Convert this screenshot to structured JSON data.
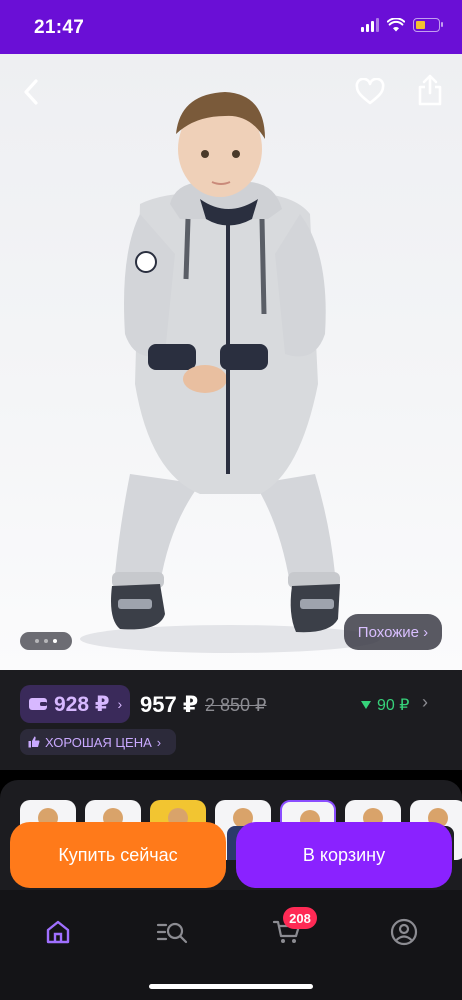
{
  "status_bar": {
    "time": "21:47",
    "icons": [
      "signal-icon",
      "wifi-icon",
      "battery-icon"
    ],
    "battery_level": 0.25,
    "colors": {
      "background": "#6a0fd6",
      "battery": "#f3c230"
    }
  },
  "photo": {
    "icons": [
      "back-icon",
      "heart-icon",
      "share-icon"
    ],
    "gallery_dots": 3,
    "active_dot": 2,
    "similar_label": "Похожие ›"
  },
  "price": {
    "wallet_price": "928 ₽",
    "wallet_chevron": "›",
    "current_price": "957 ₽",
    "old_price": "2 850 ₽",
    "bonus": "90 ₽",
    "bonus_chevron": "›",
    "good_price_badge": "ХОРОШАЯ ЦЕНА",
    "good_price_chevron": "›",
    "colors": {
      "accent": "#8a22ff",
      "bonus": "#36d27a"
    }
  },
  "variants": {
    "count": 7,
    "selected_index": 4,
    "colors": [
      "#f2c531",
      "#2f8d3a",
      "#c8243a",
      "#2b3a6b",
      "#3b4a7a",
      "#e6462d",
      "#1e1e24"
    ]
  },
  "actions": {
    "buy_now": "Купить сейчас",
    "add_to_cart": "В корзину",
    "colors": {
      "buy_now": "#ff7a1a",
      "add_to_cart": "#8a22ff"
    }
  },
  "tab_bar": {
    "items": [
      {
        "name": "home",
        "icon": "home-icon",
        "active": true
      },
      {
        "name": "catalog",
        "icon": "catalog-search-icon",
        "active": false
      },
      {
        "name": "cart",
        "icon": "cart-icon",
        "active": false
      },
      {
        "name": "profile",
        "icon": "profile-icon",
        "active": false
      }
    ],
    "cart_badge": "208"
  }
}
